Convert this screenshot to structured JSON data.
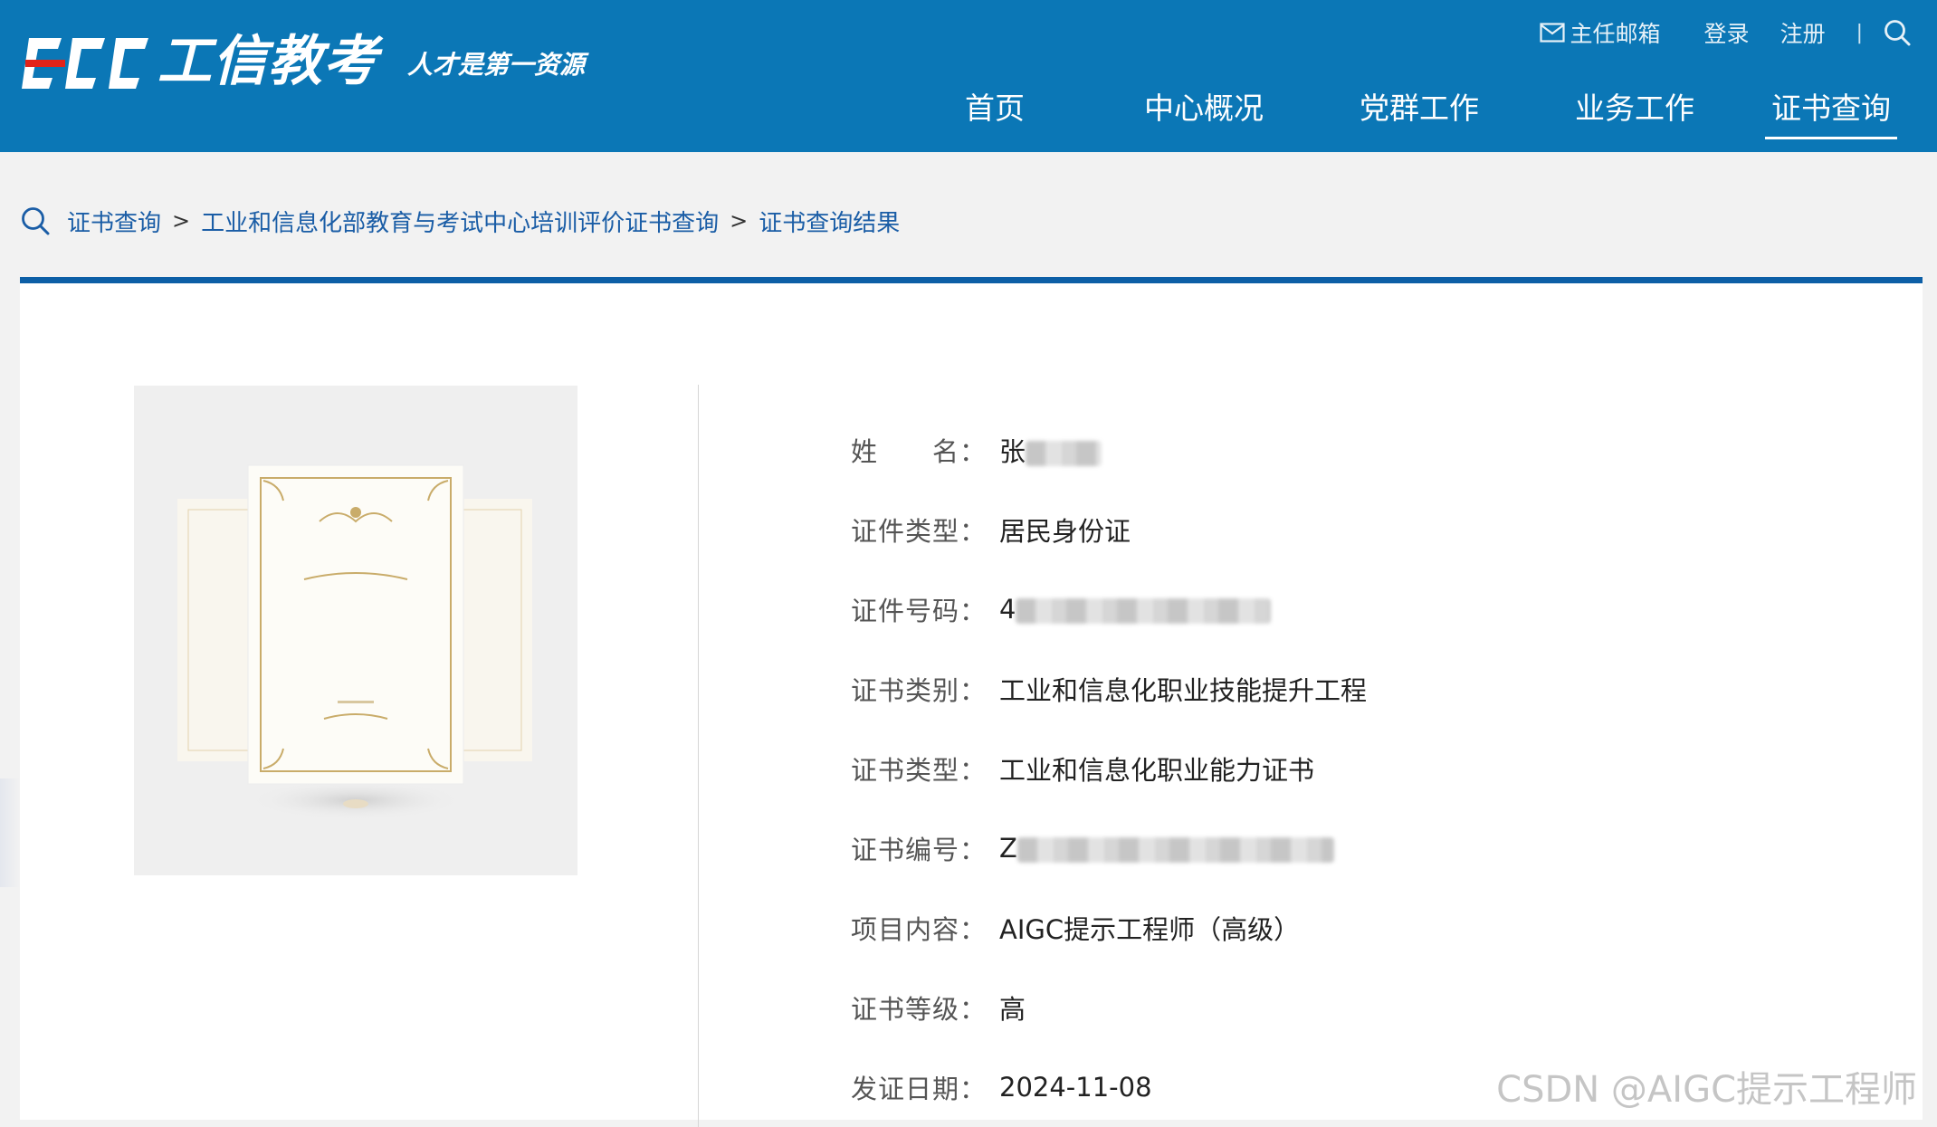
{
  "header": {
    "logo_text": "CEC",
    "brand_name": "工信教考",
    "slogan": "人才是第一资源",
    "utility": {
      "mail_label": "主任邮箱",
      "login_label": "登录",
      "register_label": "注册",
      "separator": "|"
    },
    "nav": [
      {
        "label": "首页",
        "active": false
      },
      {
        "label": "中心概况",
        "active": false
      },
      {
        "label": "党群工作",
        "active": false
      },
      {
        "label": "业务工作",
        "active": false
      },
      {
        "label": "证书查询",
        "active": true
      }
    ],
    "colors": {
      "header_bg": "#0b77b6",
      "logo_red": "#e2231a"
    }
  },
  "breadcrumb": {
    "items": [
      "证书查询",
      "工业和信息化部教育与考试中心培训评价证书查询",
      "证书查询结果"
    ],
    "separator": ">"
  },
  "certificate_info": [
    {
      "label": "姓　　名：",
      "value": "张",
      "masked": true
    },
    {
      "label": "证件类型：",
      "value": "居民身份证",
      "masked": false
    },
    {
      "label": "证件号码：",
      "value": "4",
      "masked": true
    },
    {
      "label": "证书类别：",
      "value": "工业和信息化职业技能提升工程",
      "masked": false
    },
    {
      "label": "证书类型：",
      "value": "工业和信息化职业能力证书",
      "masked": false
    },
    {
      "label": "证书编号：",
      "value": "Z",
      "masked": true
    },
    {
      "label": "项目内容：",
      "value": "AIGC提示工程师（高级）",
      "masked": false
    },
    {
      "label": "证书等级：",
      "value": "高",
      "masked": false
    },
    {
      "label": "发证日期：",
      "value": "2024-11-08",
      "masked": false
    }
  ],
  "watermark": "CSDN @AIGC提示工程师"
}
